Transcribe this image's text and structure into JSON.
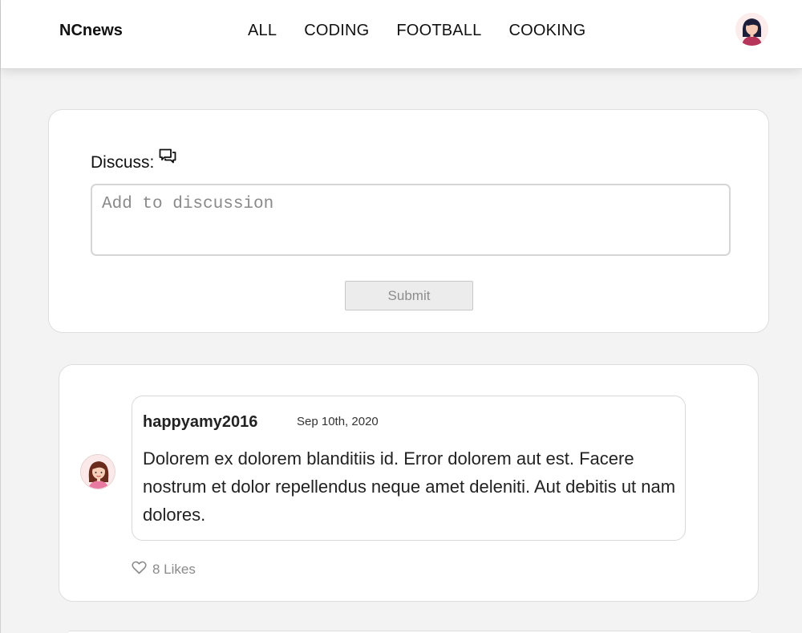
{
  "header": {
    "logo": "NCnews",
    "nav": [
      "ALL",
      "CODING",
      "FOOTBALL",
      "COOKING"
    ],
    "avatar_icon": "user-avatar-icon"
  },
  "discuss": {
    "label": "Discuss:",
    "icon": "chat-bubbles-icon",
    "placeholder": "Add to discussion",
    "value": "",
    "submit_label": "Submit"
  },
  "comments": [
    {
      "author": "happyamy2016",
      "date": "Sep 10th, 2020",
      "body": "Dolorem ex dolorem blanditiis id. Error dolorem aut est. Facere nostrum et dolor repellendus neque amet deleniti. Aut debitis ut nam dolores.",
      "likes": "8 Likes",
      "like_icon": "heart-icon"
    }
  ],
  "colors": {
    "background": "#f3f3f3",
    "card": "#ffffff",
    "muted_text": "#8a8a8a"
  }
}
